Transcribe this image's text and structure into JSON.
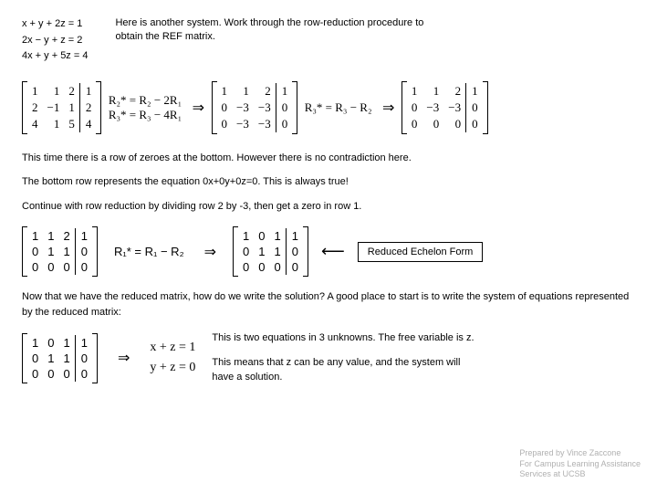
{
  "intro": "Here is another system. Work through the row-reduction procedure to obtain the REF matrix.",
  "sys": {
    "e1": "x + y + 2z = 1",
    "e2": "2x − y + z = 2",
    "e3": "4x + y + 5z = 4"
  },
  "ops1": {
    "r2": "R₂* = R₂ − 2R₁",
    "r3": "R₃* = R₃ − 4R₁",
    "r3b": "R₃* = R₃ − R₂"
  },
  "p1": "This time there is a row of zeroes at the bottom. However there is no contradiction here.",
  "p2": "The bottom row represents the equation 0x+0y+0z=0. This is always true!",
  "p3": "Continue with row reduction by dividing row 2 by -3, then get a zero in row 1.",
  "ops2": {
    "r1": "R₁* = R₁ − R₂"
  },
  "refLabel": "Reduced Echelon Form",
  "p4": "Now that we have the reduced matrix, how do we write the solution? A good place to start is to write the system of equations represented by the reduced matrix:",
  "sys2": {
    "imp": "⇒",
    "e1": "x + z = 1",
    "e2": "y + z = 0"
  },
  "b1": "This is two equations in 3 unknowns. The free variable is z.",
  "b2": "This means that z can be any value, and the system will have a solution.",
  "foot1": "Prepared by Vince Zaccone",
  "foot2": "For Campus Learning Assistance",
  "foot3": "Services at UCSB",
  "arrow": "⇒"
}
